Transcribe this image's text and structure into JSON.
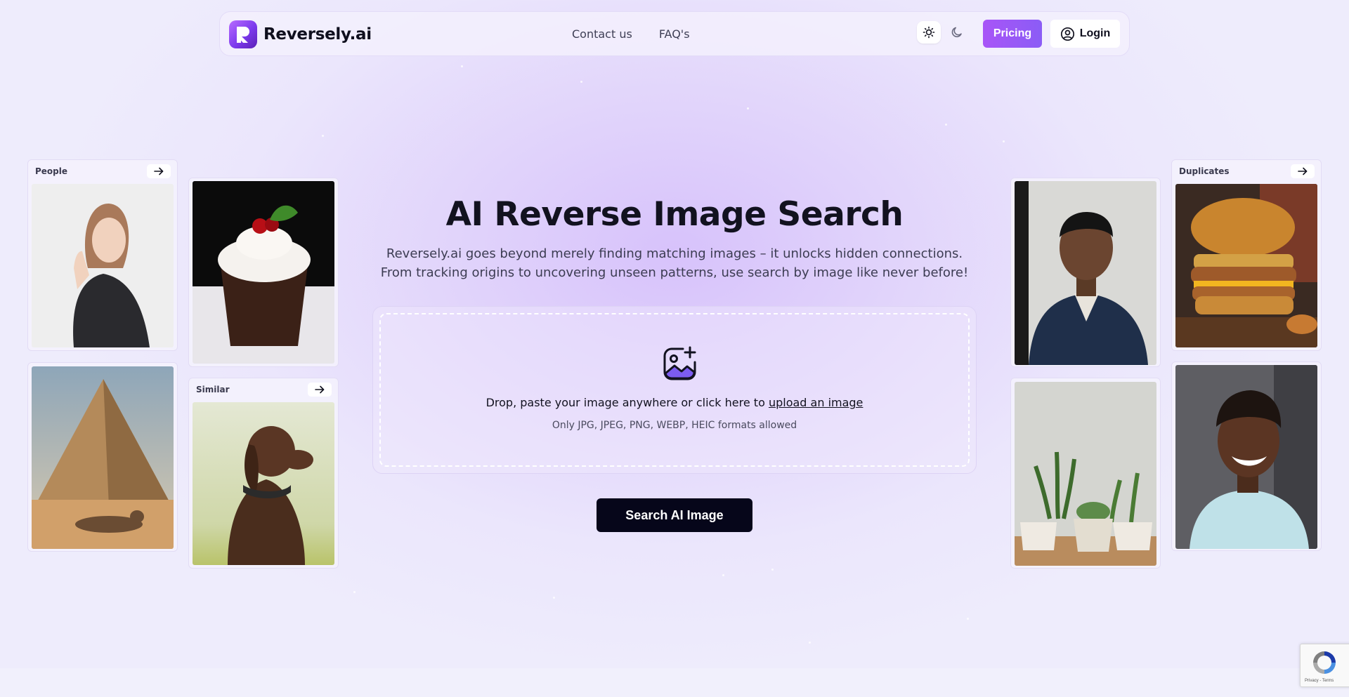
{
  "header": {
    "brand": "Reversely.ai",
    "logo_icon": "reversely-logo-icon",
    "nav": [
      {
        "label": "Contact us"
      },
      {
        "label": "FAQ's"
      }
    ],
    "theme": {
      "light_icon": "sun-icon",
      "dark_icon": "moon-icon",
      "active": "light"
    },
    "pricing_label": "Pricing",
    "login_label": "Login",
    "login_icon": "user-circle-icon"
  },
  "hero": {
    "title": "AI Reverse Image Search",
    "subtitle_line1": "Reversely.ai goes beyond merely finding matching images – it unlocks hidden connections.",
    "subtitle_line2": "From tracking origins to uncovering unseen patterns, use search by image like never before!"
  },
  "upload": {
    "icon": "image-add-icon",
    "text_prefix": "Drop, paste your image anywhere or click here to ",
    "link_text": "upload an image",
    "hint": "Only JPG, JPEG, PNG, WEBP, HEIC formats allowed"
  },
  "search_button_label": "Search AI Image",
  "cards": {
    "people_label": "People",
    "similar_label": "Similar",
    "duplicates_label": "Duplicates",
    "arrow_icon": "arrow-right-icon"
  },
  "recaptcha": {
    "terms": "Privacy - Terms"
  },
  "colors": {
    "accent": "#a855f7",
    "accent_end": "#8b5cf6",
    "primary_button": "#06061a",
    "background": "#ebe6fc"
  }
}
